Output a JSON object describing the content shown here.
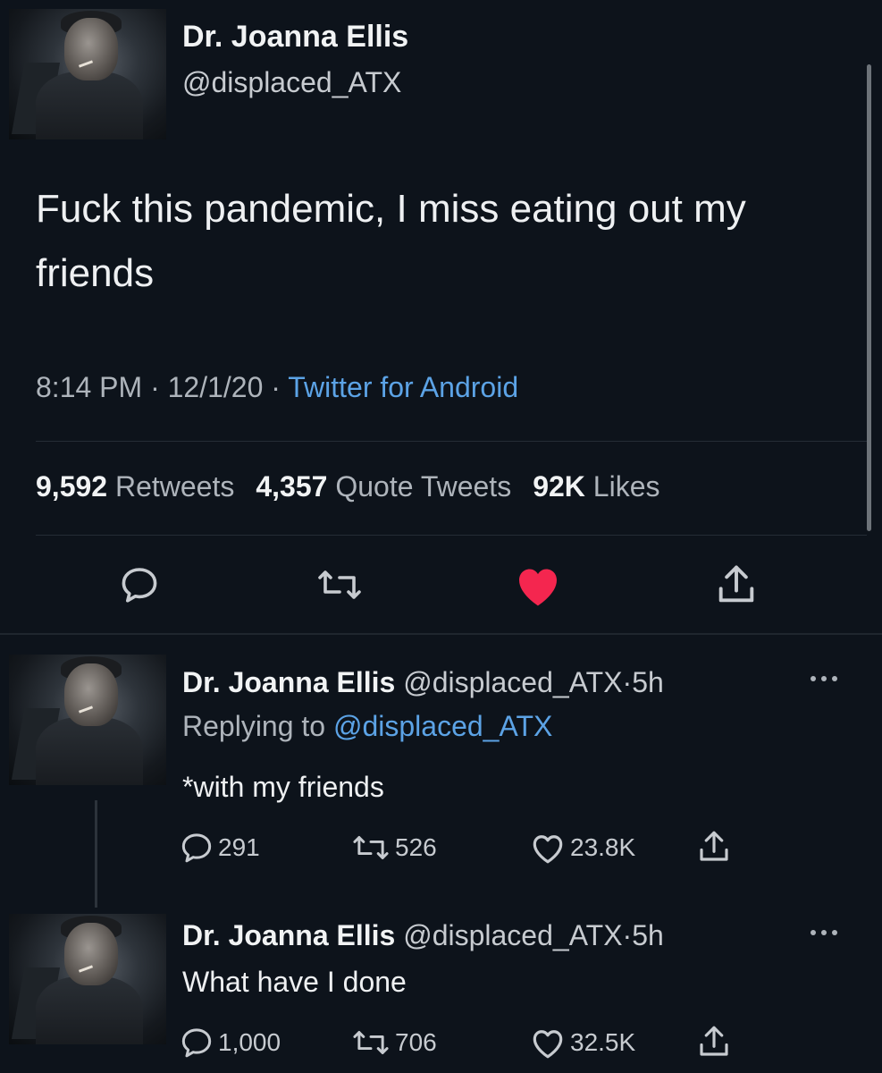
{
  "tweet": {
    "name": "Dr. Joanna Ellis",
    "handle": "@displaced_ATX",
    "text": "Fuck this pandemic, I miss eating out my friends",
    "time": "8:14 PM",
    "date": "12/1/20",
    "separator": "·",
    "source": "Twitter for Android",
    "stats": {
      "retweets_count": "9,592",
      "retweets_label": "Retweets",
      "quotes_count": "4,357",
      "quotes_label": "Quote Tweets",
      "likes_count": "92K",
      "likes_label": "Likes"
    },
    "liked": true
  },
  "replies": [
    {
      "name": "Dr. Joanna Ellis",
      "handle": "@displaced_ATX",
      "age": "5h",
      "replying_prefix": "Replying to",
      "replying_to": "@displaced_ATX",
      "text": "*with my friends",
      "reply_count": "291",
      "retweet_count": "526",
      "like_count": "23.8K"
    },
    {
      "name": "Dr. Joanna Ellis",
      "handle": "@displaced_ATX",
      "age": "5h",
      "text": "What have I done",
      "reply_count": "1,000",
      "retweet_count": "706",
      "like_count": "32.5K"
    }
  ],
  "colors": {
    "background": "#0d131b",
    "link": "#5ca3e6",
    "like": "#f4264f",
    "muted": "#aeb4bb"
  },
  "icons": [
    "reply-icon",
    "retweet-icon",
    "like-icon",
    "share-icon",
    "more-icon"
  ]
}
